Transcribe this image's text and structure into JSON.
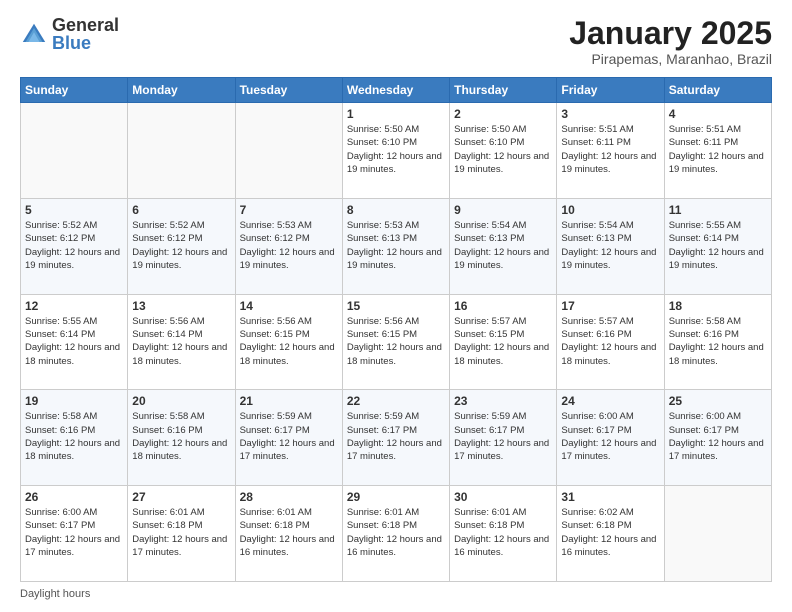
{
  "logo": {
    "general": "General",
    "blue": "Blue"
  },
  "title": "January 2025",
  "subtitle": "Pirapemas, Maranhao, Brazil",
  "weekdays": [
    "Sunday",
    "Monday",
    "Tuesday",
    "Wednesday",
    "Thursday",
    "Friday",
    "Saturday"
  ],
  "footer": "Daylight hours",
  "weeks": [
    [
      {
        "day": "",
        "info": ""
      },
      {
        "day": "",
        "info": ""
      },
      {
        "day": "",
        "info": ""
      },
      {
        "day": "1",
        "info": "Sunrise: 5:50 AM\nSunset: 6:10 PM\nDaylight: 12 hours and 19 minutes."
      },
      {
        "day": "2",
        "info": "Sunrise: 5:50 AM\nSunset: 6:10 PM\nDaylight: 12 hours and 19 minutes."
      },
      {
        "day": "3",
        "info": "Sunrise: 5:51 AM\nSunset: 6:11 PM\nDaylight: 12 hours and 19 minutes."
      },
      {
        "day": "4",
        "info": "Sunrise: 5:51 AM\nSunset: 6:11 PM\nDaylight: 12 hours and 19 minutes."
      }
    ],
    [
      {
        "day": "5",
        "info": "Sunrise: 5:52 AM\nSunset: 6:12 PM\nDaylight: 12 hours and 19 minutes."
      },
      {
        "day": "6",
        "info": "Sunrise: 5:52 AM\nSunset: 6:12 PM\nDaylight: 12 hours and 19 minutes."
      },
      {
        "day": "7",
        "info": "Sunrise: 5:53 AM\nSunset: 6:12 PM\nDaylight: 12 hours and 19 minutes."
      },
      {
        "day": "8",
        "info": "Sunrise: 5:53 AM\nSunset: 6:13 PM\nDaylight: 12 hours and 19 minutes."
      },
      {
        "day": "9",
        "info": "Sunrise: 5:54 AM\nSunset: 6:13 PM\nDaylight: 12 hours and 19 minutes."
      },
      {
        "day": "10",
        "info": "Sunrise: 5:54 AM\nSunset: 6:13 PM\nDaylight: 12 hours and 19 minutes."
      },
      {
        "day": "11",
        "info": "Sunrise: 5:55 AM\nSunset: 6:14 PM\nDaylight: 12 hours and 19 minutes."
      }
    ],
    [
      {
        "day": "12",
        "info": "Sunrise: 5:55 AM\nSunset: 6:14 PM\nDaylight: 12 hours and 18 minutes."
      },
      {
        "day": "13",
        "info": "Sunrise: 5:56 AM\nSunset: 6:14 PM\nDaylight: 12 hours and 18 minutes."
      },
      {
        "day": "14",
        "info": "Sunrise: 5:56 AM\nSunset: 6:15 PM\nDaylight: 12 hours and 18 minutes."
      },
      {
        "day": "15",
        "info": "Sunrise: 5:56 AM\nSunset: 6:15 PM\nDaylight: 12 hours and 18 minutes."
      },
      {
        "day": "16",
        "info": "Sunrise: 5:57 AM\nSunset: 6:15 PM\nDaylight: 12 hours and 18 minutes."
      },
      {
        "day": "17",
        "info": "Sunrise: 5:57 AM\nSunset: 6:16 PM\nDaylight: 12 hours and 18 minutes."
      },
      {
        "day": "18",
        "info": "Sunrise: 5:58 AM\nSunset: 6:16 PM\nDaylight: 12 hours and 18 minutes."
      }
    ],
    [
      {
        "day": "19",
        "info": "Sunrise: 5:58 AM\nSunset: 6:16 PM\nDaylight: 12 hours and 18 minutes."
      },
      {
        "day": "20",
        "info": "Sunrise: 5:58 AM\nSunset: 6:16 PM\nDaylight: 12 hours and 18 minutes."
      },
      {
        "day": "21",
        "info": "Sunrise: 5:59 AM\nSunset: 6:17 PM\nDaylight: 12 hours and 17 minutes."
      },
      {
        "day": "22",
        "info": "Sunrise: 5:59 AM\nSunset: 6:17 PM\nDaylight: 12 hours and 17 minutes."
      },
      {
        "day": "23",
        "info": "Sunrise: 5:59 AM\nSunset: 6:17 PM\nDaylight: 12 hours and 17 minutes."
      },
      {
        "day": "24",
        "info": "Sunrise: 6:00 AM\nSunset: 6:17 PM\nDaylight: 12 hours and 17 minutes."
      },
      {
        "day": "25",
        "info": "Sunrise: 6:00 AM\nSunset: 6:17 PM\nDaylight: 12 hours and 17 minutes."
      }
    ],
    [
      {
        "day": "26",
        "info": "Sunrise: 6:00 AM\nSunset: 6:17 PM\nDaylight: 12 hours and 17 minutes."
      },
      {
        "day": "27",
        "info": "Sunrise: 6:01 AM\nSunset: 6:18 PM\nDaylight: 12 hours and 17 minutes."
      },
      {
        "day": "28",
        "info": "Sunrise: 6:01 AM\nSunset: 6:18 PM\nDaylight: 12 hours and 16 minutes."
      },
      {
        "day": "29",
        "info": "Sunrise: 6:01 AM\nSunset: 6:18 PM\nDaylight: 12 hours and 16 minutes."
      },
      {
        "day": "30",
        "info": "Sunrise: 6:01 AM\nSunset: 6:18 PM\nDaylight: 12 hours and 16 minutes."
      },
      {
        "day": "31",
        "info": "Sunrise: 6:02 AM\nSunset: 6:18 PM\nDaylight: 12 hours and 16 minutes."
      },
      {
        "day": "",
        "info": ""
      }
    ]
  ]
}
